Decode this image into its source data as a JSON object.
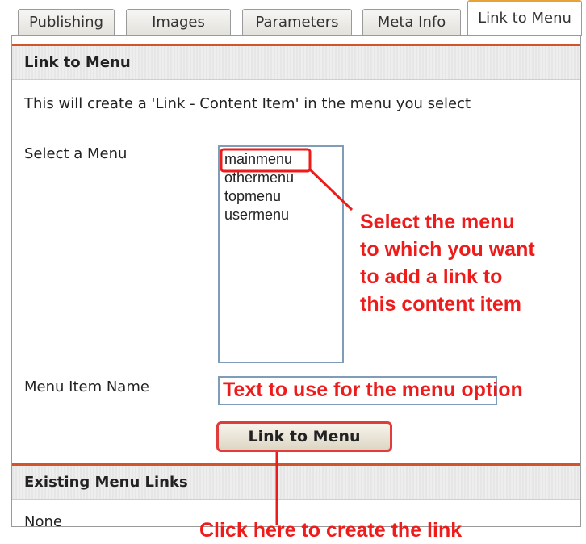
{
  "tabs": [
    {
      "label": "Publishing",
      "active": false
    },
    {
      "label": "Images",
      "active": false
    },
    {
      "label": "Parameters",
      "active": false
    },
    {
      "label": "Meta Info",
      "active": false
    },
    {
      "label": "Link to Menu",
      "active": true
    }
  ],
  "link_section": {
    "title": "Link to Menu",
    "description": "This will create a 'Link - Content Item' in the menu you select",
    "select_label": "Select a Menu",
    "menu_options": [
      "mainmenu",
      "othermenu",
      "topmenu",
      "usermenu"
    ],
    "name_label": "Menu Item Name",
    "name_value": "",
    "button_label": "Link to Menu"
  },
  "existing_section": {
    "title": "Existing Menu Links",
    "value": "None"
  },
  "annotations": {
    "select_hint": [
      "Select the menu",
      "to which you want",
      "to add a link to",
      "this content item"
    ],
    "text_hint": "Text to use for the menu option",
    "button_hint": "Click here to create the link",
    "color": "#ee1b1b"
  },
  "colors": {
    "accent_line": "#d3542a",
    "active_tab_top": "#e8a23a",
    "field_border": "#7f9db9"
  }
}
